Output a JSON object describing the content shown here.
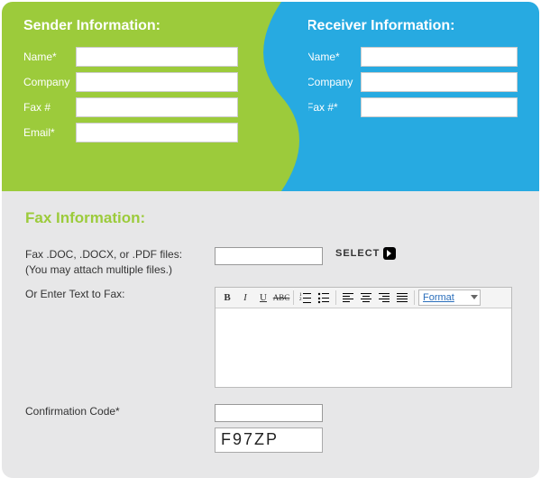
{
  "sender": {
    "title": "Sender Information:",
    "fields": {
      "name": {
        "label": "Name*",
        "value": ""
      },
      "company": {
        "label": "Company",
        "value": ""
      },
      "fax": {
        "label": "Fax #",
        "value": ""
      },
      "email": {
        "label": "Email*",
        "value": ""
      }
    }
  },
  "receiver": {
    "title": "Receiver Information:",
    "fields": {
      "name": {
        "label": "Name*",
        "value": ""
      },
      "company": {
        "label": "Company",
        "value": ""
      },
      "fax": {
        "label": "Fax #*",
        "value": ""
      }
    }
  },
  "fax": {
    "title": "Fax Information:",
    "fileLabelLine1": "Fax .DOC, .DOCX, or .PDF files:",
    "fileLabelLine2": "(You may attach multiple files.)",
    "selectLabel": "SELECT",
    "textLabel": "Or Enter Text to Fax:",
    "toolbar": {
      "bold": "B",
      "italic": "I",
      "underline": "U",
      "strike": "ABC",
      "format": "Format"
    },
    "textValue": "",
    "confirmLabel": "Confirmation Code*",
    "confirmValue": "",
    "captcha": "F97ZP"
  }
}
